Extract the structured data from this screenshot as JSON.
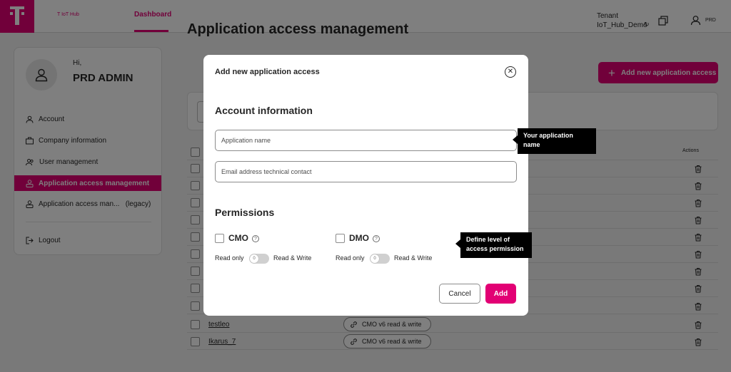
{
  "header": {
    "brand": "T IoT Hub",
    "nav_dashboard": "Dashboard",
    "tenant_label": "Tenant",
    "tenant_value": "IoT_Hub_Demo",
    "user_code": "PRD",
    "accent_color": "#e20074",
    "icons": [
      "telekom-logo",
      "sync-icon",
      "copy-icon",
      "user-icon"
    ]
  },
  "page": {
    "title": "Application access management",
    "add_button": "Add new application access",
    "actions_header": "Actions"
  },
  "sidebar": {
    "greeting": "Hi,",
    "user_name": "PRD ADMIN",
    "items": [
      {
        "label": "Account",
        "icon": "account-icon"
      },
      {
        "label": "Company information",
        "icon": "briefcase-icon"
      },
      {
        "label": "User management",
        "icon": "users-icon"
      },
      {
        "label": "Application access management",
        "icon": "app-user-icon",
        "active": true
      },
      {
        "label": "Application access man...   (legacy)",
        "icon": "app-user-legacy-icon"
      }
    ],
    "logout": "Logout"
  },
  "table": {
    "rows": [
      {
        "name": "testleo",
        "permission": "CMO v6 read & write"
      },
      {
        "name": "Ikarus_7",
        "permission": "CMO v6 read & write"
      }
    ]
  },
  "modal": {
    "title": "Add new application access",
    "section_account": "Account information",
    "app_name_placeholder": "Application name",
    "email_placeholder": "Email address technical contact",
    "section_permissions": "Permissions",
    "cmo_label": "CMO",
    "dmo_label": "DMO",
    "help_glyph": "?",
    "read_only": "Read only",
    "read_write": "Read & Write",
    "toggle_value": "0",
    "cancel": "Cancel",
    "add": "Add"
  },
  "tooltips": {
    "app_name": "Your application name",
    "permission": "Define level of access permission"
  }
}
